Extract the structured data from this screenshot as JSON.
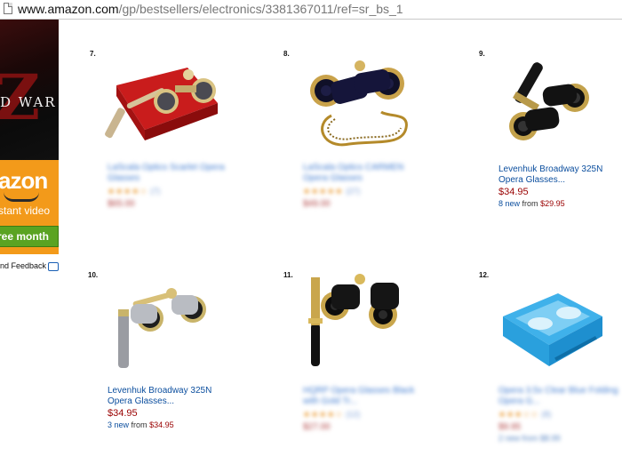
{
  "browser": {
    "url_host": "www.amazon.com",
    "url_path": "/gp/bestsellers/electronics/3381367011/ref=sr_bs_1"
  },
  "ad": {
    "movie_text": "D WAR",
    "movie_letter": "Z",
    "brand": "azon",
    "tagline": "stant video",
    "cta": "ree month",
    "feedback": "nd Feedback"
  },
  "products": [
    {
      "rank": "7.",
      "image_icon": "red-case-opera-glasses-image",
      "title": "LaScala Optics Scarlet Opera Glasses",
      "stars": "★★★★☆",
      "reviews": "(7)",
      "price": "$65.00",
      "blurred": true
    },
    {
      "rank": "8.",
      "image_icon": "chain-opera-glasses-image",
      "title": "LaScala Optics CARMEN Opera Glasses",
      "stars": "★★★★★",
      "reviews": "(27)",
      "price": "$49.00",
      "blurred": true
    },
    {
      "rank": "9.",
      "image_icon": "black-gold-opera-glasses-image",
      "title_line1": "Levenhuk Broadway 325N",
      "title_line2": "Opera Glasses...",
      "price": "$34.95",
      "offers_new": "8 new",
      "offers_from": "from",
      "offers_price": "$29.95",
      "blurred": false
    },
    {
      "rank": "10.",
      "image_icon": "silver-opera-glasses-image",
      "title_line1": "Levenhuk Broadway 325N",
      "title_line2": "Opera Glasses...",
      "price": "$34.95",
      "offers_new": "3 new",
      "offers_from": "from",
      "offers_price": "$34.95",
      "blurred": false
    },
    {
      "rank": "11.",
      "image_icon": "handle-opera-glasses-image",
      "title": "HQRP Opera Glasses Black with Gold Tr...",
      "stars": "★★★★☆",
      "reviews": "(12)",
      "price": "$27.00",
      "blurred": true
    },
    {
      "rank": "12.",
      "image_icon": "blue-folding-opera-glasses-image",
      "title": "Opera 3.5x Clear Blue Folding Opera G...",
      "stars": "★★★☆☆",
      "reviews": "(8)",
      "price": "$9.95",
      "offers": "2 new from $8.99",
      "blurred": true
    }
  ],
  "colors": {
    "link": "#0b4e9e",
    "price": "#990000",
    "star": "#e88b12",
    "ad_orange": "#f39a1a",
    "ad_cta": "#5aa322"
  }
}
